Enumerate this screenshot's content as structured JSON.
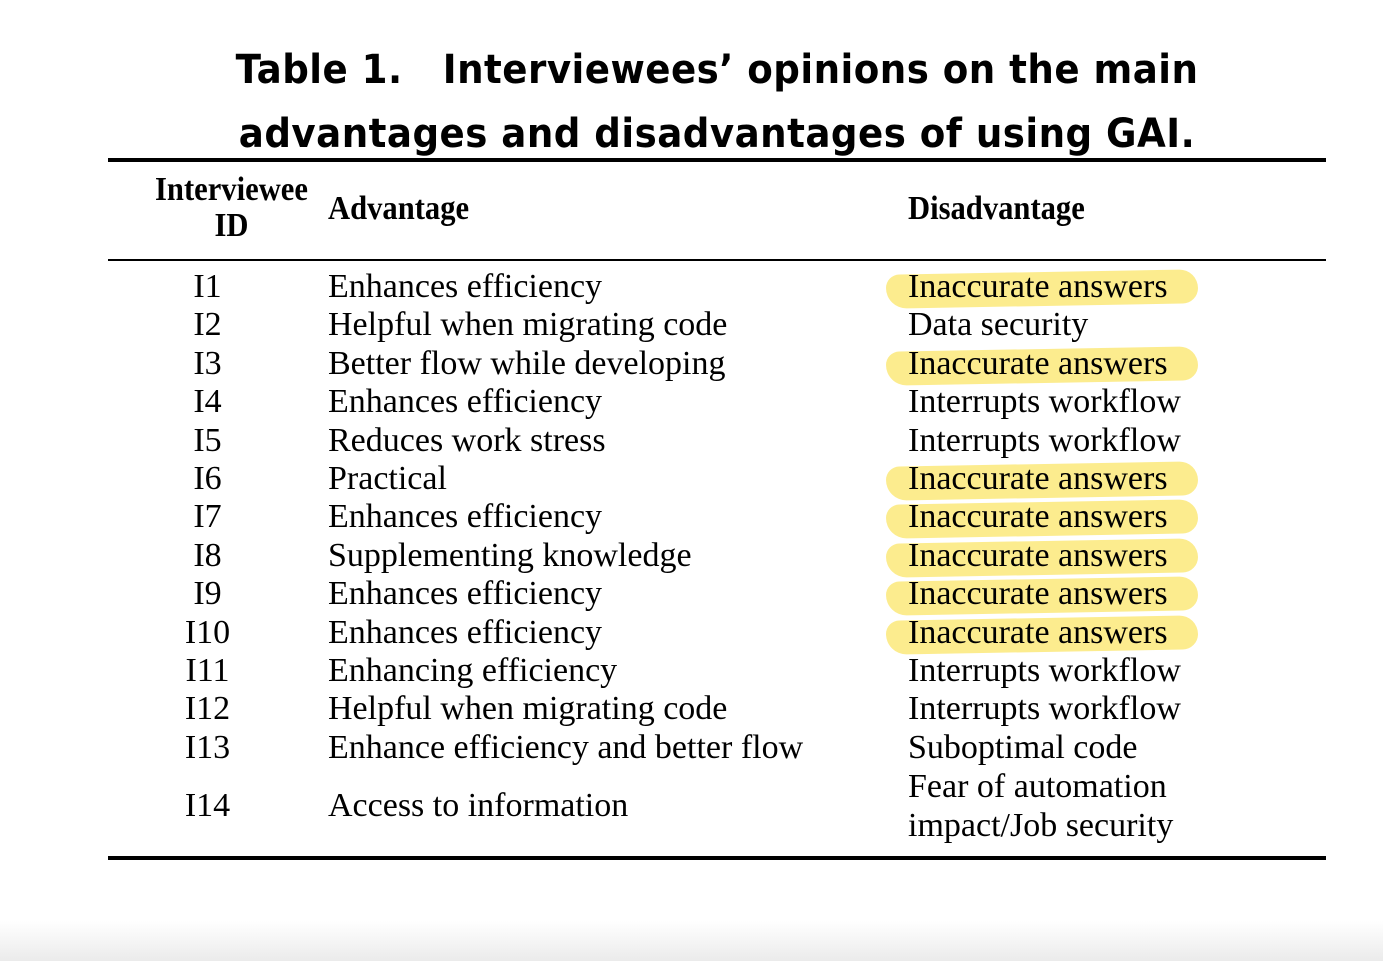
{
  "caption": {
    "line1": "Table 1.   Interviewees’ opinions on the main",
    "line2": "advantages and disadvantages of using GAI."
  },
  "headers": {
    "id_line1": "Interviewee",
    "id_line2": "ID",
    "advantage": "Advantage",
    "disadvantage": "Disadvantage"
  },
  "highlight_color": "#fbe97a",
  "rows": [
    {
      "id": "I1",
      "advantage": "Enhances efficiency",
      "disadvantage": "Inaccurate answers",
      "highlighted": true
    },
    {
      "id": "I2",
      "advantage": "Helpful when migrating code",
      "disadvantage": "Data security",
      "highlighted": false
    },
    {
      "id": "I3",
      "advantage": "Better flow while developing",
      "disadvantage": "Inaccurate answers",
      "highlighted": true
    },
    {
      "id": "I4",
      "advantage": "Enhances efficiency",
      "disadvantage": "Interrupts workflow",
      "highlighted": false
    },
    {
      "id": "I5",
      "advantage": "Reduces work stress",
      "disadvantage": "Interrupts workflow",
      "highlighted": false
    },
    {
      "id": "I6",
      "advantage": "Practical",
      "disadvantage": "Inaccurate answers",
      "highlighted": true
    },
    {
      "id": "I7",
      "advantage": "Enhances efficiency",
      "disadvantage": "Inaccurate answers",
      "highlighted": true
    },
    {
      "id": "I8",
      "advantage": "Supplementing knowledge",
      "disadvantage": "Inaccurate answers",
      "highlighted": true
    },
    {
      "id": "I9",
      "advantage": "Enhances efficiency",
      "disadvantage": "Inaccurate answers",
      "highlighted": true
    },
    {
      "id": "I10",
      "advantage": "Enhances efficiency",
      "disadvantage": "Inaccurate answers",
      "highlighted": true
    },
    {
      "id": "I11",
      "advantage": "Enhancing efficiency",
      "disadvantage": "Interrupts workflow",
      "highlighted": false
    },
    {
      "id": "I12",
      "advantage": "Helpful when migrating code",
      "disadvantage": "Interrupts workflow",
      "highlighted": false
    },
    {
      "id": "I13",
      "advantage": "Enhance efficiency and better flow",
      "disadvantage": "Suboptimal code",
      "highlighted": false
    },
    {
      "id": "I14",
      "advantage": "Access to information",
      "disadvantage": "Fear of automation impact/Job security",
      "highlighted": false
    }
  ]
}
